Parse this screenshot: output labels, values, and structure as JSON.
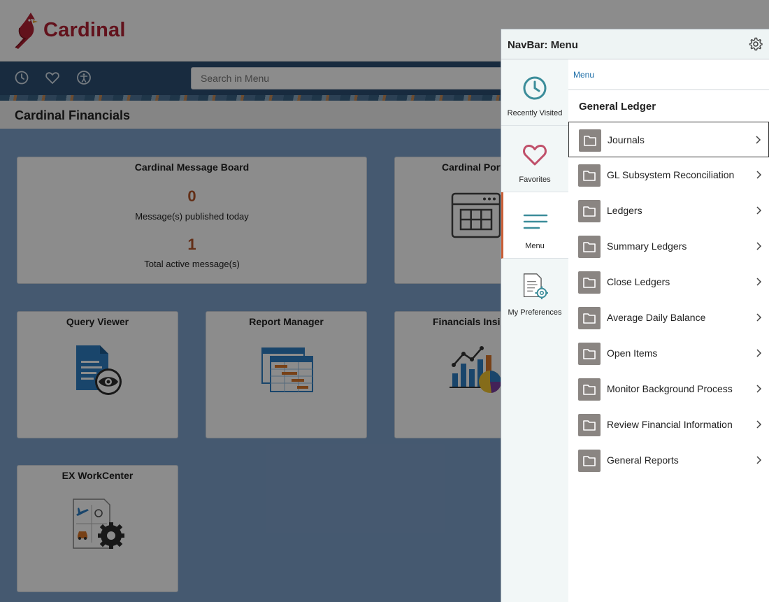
{
  "brand": {
    "name": "Cardinal",
    "color": "#b22234"
  },
  "toolbar": {
    "icons": [
      "clock-icon",
      "heart-icon",
      "accessibility-icon"
    ],
    "search_placeholder": "Search in Menu"
  },
  "page": {
    "title": "Cardinal Financials"
  },
  "tiles": {
    "message_board": {
      "title": "Cardinal Message Board",
      "published_count": "0",
      "published_label": "Message(s) published today",
      "active_count": "1",
      "active_label": "Total active message(s)"
    },
    "portal": {
      "title": "Cardinal Port"
    },
    "query_viewer": {
      "title": "Query Viewer"
    },
    "report_manager": {
      "title": "Report Manager"
    },
    "financials_insight": {
      "title": "Financials Insig"
    },
    "ex_workcenter": {
      "title": "EX WorkCenter"
    }
  },
  "navbar": {
    "title": "NavBar: Menu",
    "side": [
      {
        "label": "Recently Visited",
        "icon": "clock-icon"
      },
      {
        "label": "Favorites",
        "icon": "heart-icon"
      },
      {
        "label": "Menu",
        "icon": "menu-lines-icon"
      },
      {
        "label": "My Preferences",
        "icon": "preferences-icon"
      }
    ],
    "breadcrumb": "Menu",
    "section": "General Ledger",
    "items": [
      {
        "label": "Journals"
      },
      {
        "label": "GL Subsystem Reconciliation"
      },
      {
        "label": "Ledgers"
      },
      {
        "label": "Summary Ledgers"
      },
      {
        "label": "Close Ledgers"
      },
      {
        "label": "Average Daily Balance"
      },
      {
        "label": "Open Items"
      },
      {
        "label": "Monitor Background Process"
      },
      {
        "label": "Review Financial Information"
      },
      {
        "label": "General Reports"
      }
    ],
    "selected_index": 0
  },
  "colors": {
    "accent_teal": "#3c8d9a",
    "favorites_pink": "#c0506a",
    "active_marker": "#c95f37",
    "link_blue": "#1f6fa8"
  }
}
